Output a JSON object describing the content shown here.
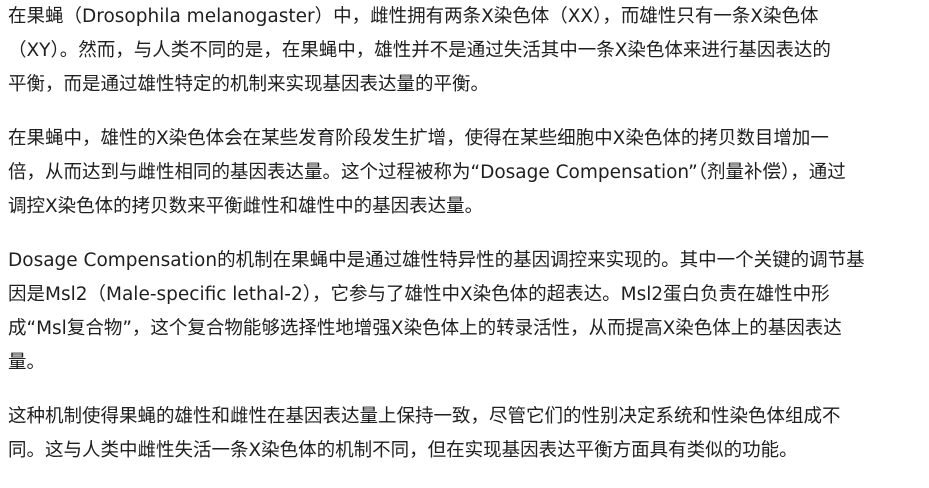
{
  "paragraphs": [
    {
      "lines": [
        "在果蝇（Drosophila melanogaster）中，雌性拥有两条X染色体（XX），而雄性只有一条X染色体",
        "（XY）。然而，与人类不同的是，在果蝇中，雄性并不是通过失活其中一条X染色体来进行基因表达的",
        "平衡，而是通过雄性特定的机制来实现基因表达量的平衡。"
      ]
    },
    {
      "lines": [
        "在果蝇中，雄性的X染色体会在某些发育阶段发生扩增，使得在某些细胞中X染色体的拷贝数目增加一",
        "倍，从而达到与雌性相同的基因表达量。这个过程被称为“Dosage Compensation”（剂量补偿），通过",
        "调控X染色体的拷贝数来平衡雌性和雄性中的基因表达量。"
      ]
    },
    {
      "lines": [
        "Dosage Compensation的机制在果蝇中是通过雄性特异性的基因调控来实现的。其中一个关键的调节基",
        "因是Msl2（Male-specific lethal-2），它参与了雄性中X染色体的超表达。Msl2蛋白负责在雄性中形",
        "成“Msl复合物”，这个复合物能够选择性地增强X染色体上的转录活性，从而提高X染色体上的基因表达",
        "量。"
      ]
    },
    {
      "lines": [
        "这种机制使得果蝇的雄性和雌性在基因表达量上保持一致，尽管它们的性别决定系统和性染色体组成不",
        "同。这与人类中雌性失活一条X染色体的机制不同，但在实现基因表达平衡方面具有类似的功能。"
      ]
    }
  ]
}
